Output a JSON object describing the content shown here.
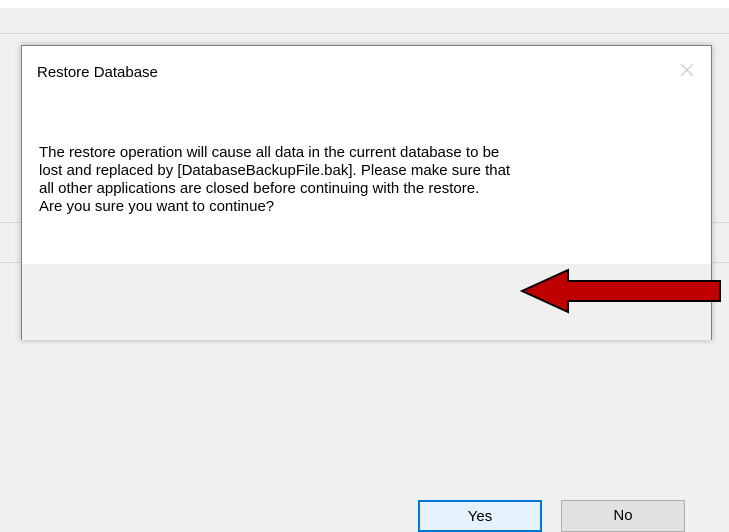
{
  "dialog": {
    "title": "Restore Database",
    "close_icon": "close-icon",
    "message": "The restore operation will cause all data in the current database to be\nlost and replaced by [DatabaseBackupFile.bak].  Please make sure that\nall other applications are closed before continuing with the restore.\nAre you sure you want to continue?",
    "buttons": {
      "yes_label": "Yes",
      "no_label": "No"
    }
  },
  "annotation": {
    "arrow_icon": "red-arrow-icon",
    "arrow_color": "#c00000"
  },
  "colors": {
    "focus_border": "#0078d7",
    "footer_bg": "#f0f0f0"
  }
}
